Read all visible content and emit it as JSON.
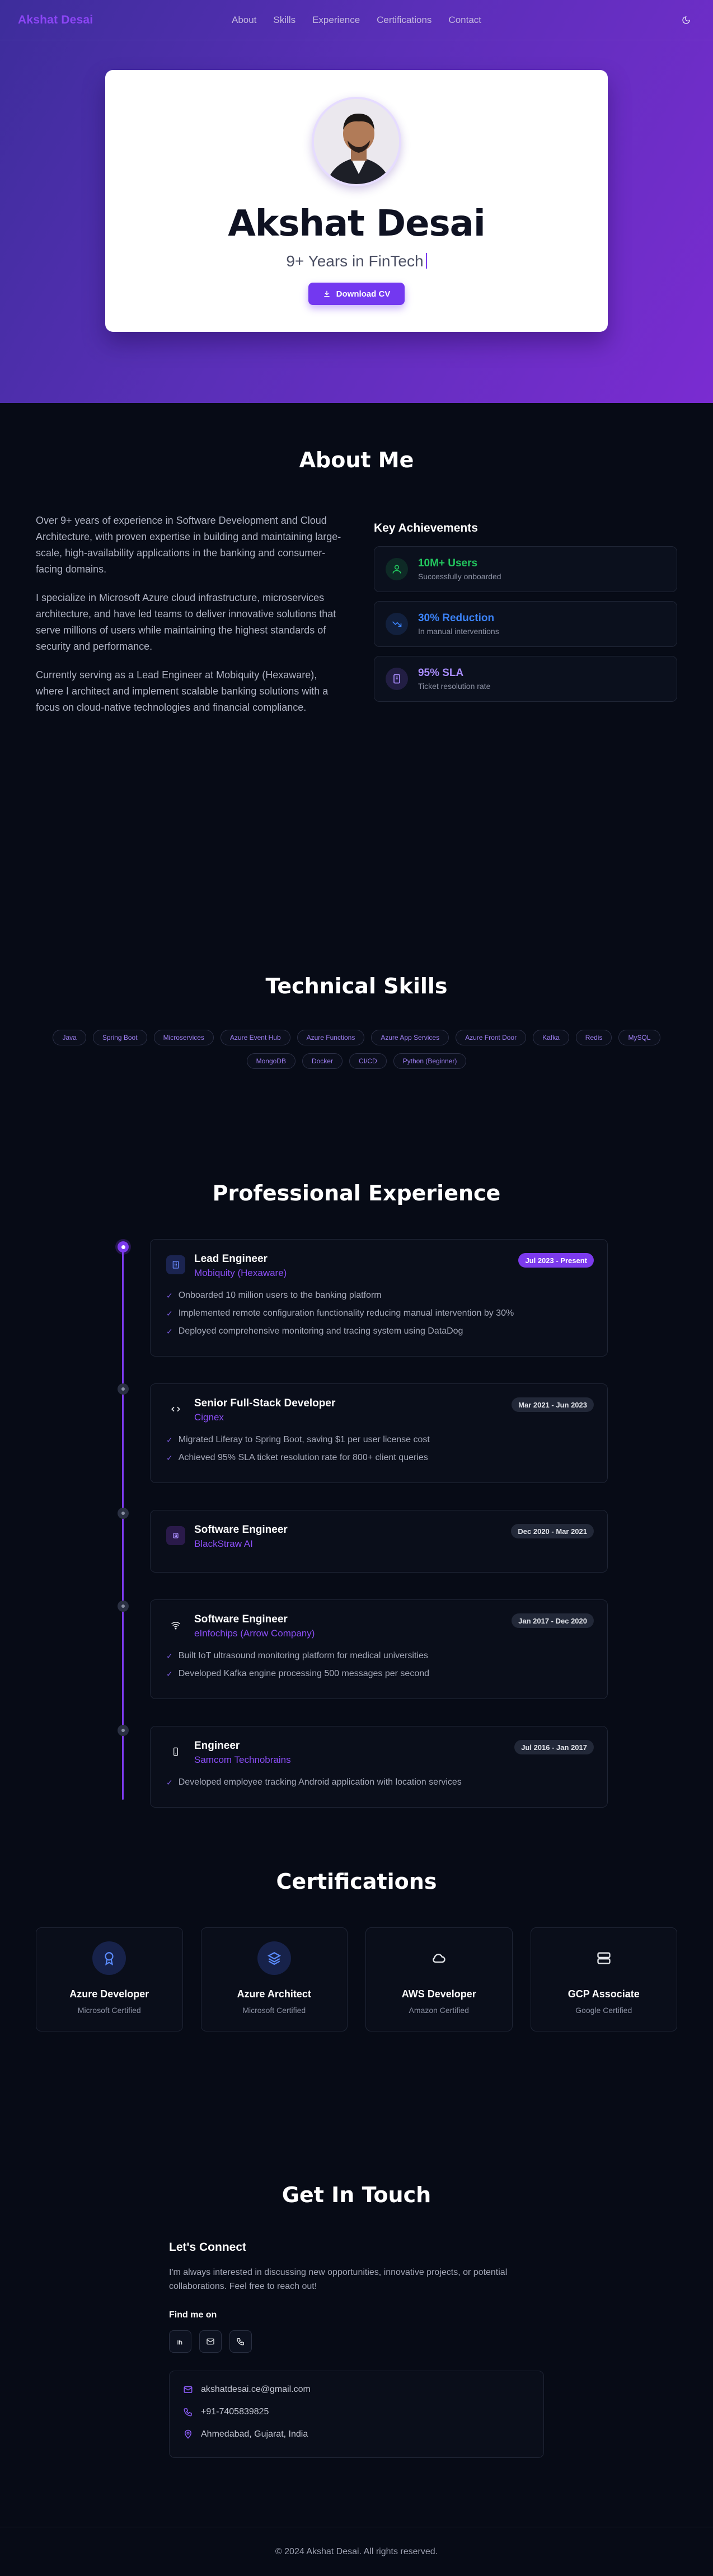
{
  "nav": {
    "brand": "Akshat Desai",
    "links": [
      "About",
      "Skills",
      "Experience",
      "Certifications",
      "Contact"
    ]
  },
  "hero": {
    "name": "Akshat Desai",
    "subtitle": "9+ Years in FinTech",
    "cv_label": "Download CV"
  },
  "about": {
    "title": "About Me",
    "paragraphs": [
      "Over 9+ years of experience in Software Development and Cloud Architecture, with proven expertise in building and maintaining large-scale, high-availability applications in the banking and consumer-facing domains.",
      "I specialize in Microsoft Azure cloud infrastructure, microservices architecture, and have led teams to deliver innovative solutions that serve millions of users while maintaining the highest standards of security and performance.",
      "Currently serving as a Lead Engineer at Mobiquity (Hexaware), where I architect and implement scalable banking solutions with a focus on cloud-native technologies and financial compliance."
    ],
    "achievements_title": "Key Achievements",
    "achievements": [
      {
        "title": "10M+ Users",
        "sub": "Successfully onboarded",
        "color": "#22c55e"
      },
      {
        "title": "30% Reduction",
        "sub": "In manual interventions",
        "color": "#3b82f6"
      },
      {
        "title": "95% SLA",
        "sub": "Ticket resolution rate",
        "color": "#8b5cf6"
      }
    ]
  },
  "skills": {
    "title": "Technical Skills",
    "items": [
      "Java",
      "Spring Boot",
      "Microservices",
      "Azure Event Hub",
      "Azure Functions",
      "Azure App Services",
      "Azure Front Door",
      "Kafka",
      "Redis",
      "MySQL",
      "MongoDB",
      "Docker",
      "CI/CD",
      "Python (Beginner)"
    ]
  },
  "experience": {
    "title": "Professional Experience",
    "jobs": [
      {
        "title": "Lead Engineer",
        "company": "Mobiquity (Hexaware)",
        "date": "Jul 2023 - Present",
        "active": true,
        "icon": "building-icon",
        "bullets": [
          "Onboarded 10 million users to the banking platform",
          "Implemented remote configuration functionality reducing manual intervention by 30%",
          "Deployed comprehensive monitoring and tracing system using DataDog"
        ]
      },
      {
        "title": "Senior Full-Stack Developer",
        "company": "Cignex",
        "date": "Mar 2021 - Jun 2023",
        "active": false,
        "icon": "code-icon",
        "bullets": [
          "Migrated Liferay to Spring Boot, saving $1 per user license cost",
          "Achieved 95% SLA ticket resolution rate for 800+ client queries"
        ]
      },
      {
        "title": "Software Engineer",
        "company": "BlackStraw AI",
        "date": "Dec 2020 - Mar 2021",
        "active": false,
        "icon": "cpu-icon",
        "bullets": []
      },
      {
        "title": "Software Engineer",
        "company": "eInfochips (Arrow Company)",
        "date": "Jan 2017 - Dec 2020",
        "active": false,
        "icon": "wifi-icon",
        "bullets": [
          "Built IoT ultrasound monitoring platform for medical universities",
          "Developed Kafka engine processing 500 messages per second"
        ]
      },
      {
        "title": "Engineer",
        "company": "Samcom Technobrains",
        "date": "Jul 2016 - Jan 2017",
        "active": false,
        "icon": "phone-icon",
        "bullets": [
          "Developed employee tracking Android application with location services"
        ]
      }
    ]
  },
  "certifications": {
    "title": "Certifications",
    "items": [
      {
        "name": "Azure Developer",
        "issuer": "Microsoft Certified",
        "icon": "award-icon"
      },
      {
        "name": "Azure Architect",
        "issuer": "Microsoft Certified",
        "icon": "layers-icon"
      },
      {
        "name": "AWS Developer",
        "issuer": "Amazon Certified",
        "icon": "cloud-icon"
      },
      {
        "name": "GCP Associate",
        "issuer": "Google Certified",
        "icon": "server-icon"
      }
    ]
  },
  "contact": {
    "title": "Get In Touch",
    "heading": "Let's Connect",
    "lead": "I'm always interested in discussing new opportunities, innovative projects, or potential collaborations. Feel free to reach out!",
    "find_me": "Find me on",
    "email": "akshatdesai.ce@gmail.com",
    "phone": "+91-7405839825",
    "location": "Ahmedabad, Gujarat, India"
  },
  "footer": {
    "text": "© 2024 Akshat Desai. All rights reserved."
  }
}
